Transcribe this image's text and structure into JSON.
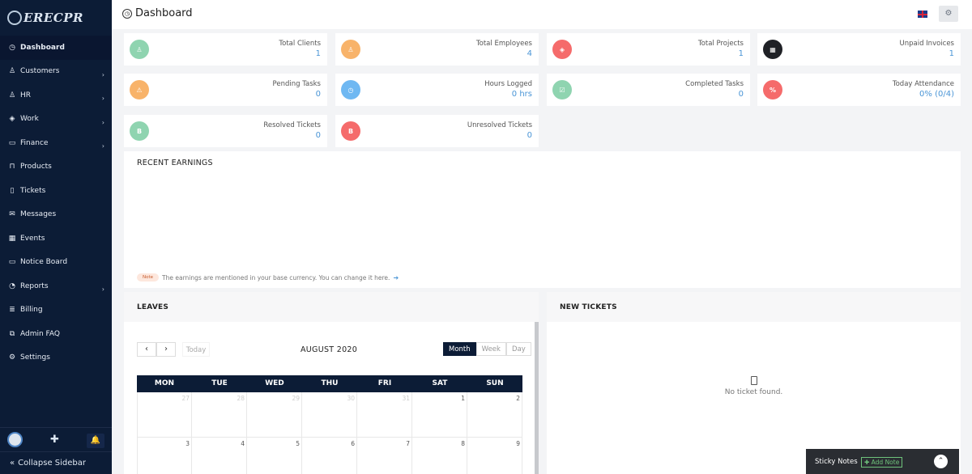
{
  "app": {
    "logo_text": "ERECPR",
    "title": "Dashboard"
  },
  "sidebar": {
    "items": [
      {
        "label": "Dashboard",
        "icon": "dashboard-icon",
        "chevron": false
      },
      {
        "label": "Customers",
        "icon": "user-icon",
        "chevron": true
      },
      {
        "label": "HR",
        "icon": "user-icon",
        "chevron": true
      },
      {
        "label": "Work",
        "icon": "layers-icon",
        "chevron": true
      },
      {
        "label": "Finance",
        "icon": "money-icon",
        "chevron": true
      },
      {
        "label": "Products",
        "icon": "bag-icon",
        "chevron": false
      },
      {
        "label": "Tickets",
        "icon": "ticket-icon",
        "chevron": false
      },
      {
        "label": "Messages",
        "icon": "envelope-icon",
        "chevron": false
      },
      {
        "label": "Events",
        "icon": "calendar-icon",
        "chevron": false
      },
      {
        "label": "Notice Board",
        "icon": "monitor-icon",
        "chevron": false
      },
      {
        "label": "Reports",
        "icon": "pie-chart-icon",
        "chevron": true
      },
      {
        "label": "Billing",
        "icon": "billing-icon",
        "chevron": false
      },
      {
        "label": "Admin FAQ",
        "icon": "faq-icon",
        "chevron": false
      },
      {
        "label": "Settings",
        "icon": "gear-icon",
        "chevron": false
      }
    ],
    "collapse_label": "Collapse Sidebar"
  },
  "stats": [
    {
      "label": "Total Clients",
      "value": "1",
      "color": "#8fd4b0"
    },
    {
      "label": "Total Employees",
      "value": "4",
      "color": "#f8b36a"
    },
    {
      "label": "Total Projects",
      "value": "1",
      "color": "#f56b6b"
    },
    {
      "label": "Unpaid Invoices",
      "value": "1",
      "color": "#1f2126"
    },
    {
      "label": "Pending Tasks",
      "value": "0",
      "color": "#f8b36a"
    },
    {
      "label": "Hours Logged",
      "value": "0 hrs",
      "color": "#6fb8f2"
    },
    {
      "label": "Completed Tasks",
      "value": "0",
      "color": "#8fd4b0"
    },
    {
      "label": "Today Attendance",
      "value": "0% (0/4)",
      "color": "#f56b6b"
    },
    {
      "label": "Resolved Tickets",
      "value": "0",
      "color": "#8fd4b0"
    },
    {
      "label": "Unresolved Tickets",
      "value": "0",
      "color": "#f56b6b"
    }
  ],
  "earnings": {
    "title": "RECENT EARNINGS",
    "note_badge": "Note",
    "note_text": "The earnings are mentioned in your base currency. You can change it here."
  },
  "leaves": {
    "title": "LEAVES",
    "today_label": "Today",
    "month_label": "AUGUST 2020",
    "views": [
      "Month",
      "Week",
      "Day"
    ],
    "days": [
      "MON",
      "TUE",
      "WED",
      "THU",
      "FRI",
      "SAT",
      "SUN"
    ],
    "rows": [
      [
        "27",
        "28",
        "29",
        "30",
        "31",
        "1",
        "2"
      ],
      [
        "3",
        "4",
        "5",
        "6",
        "7",
        "8",
        "9"
      ]
    ]
  },
  "tickets": {
    "title": "NEW TICKETS",
    "empty_text": "No ticket found."
  },
  "sticky": {
    "title": "Sticky Notes",
    "add_label": "Add Note"
  }
}
